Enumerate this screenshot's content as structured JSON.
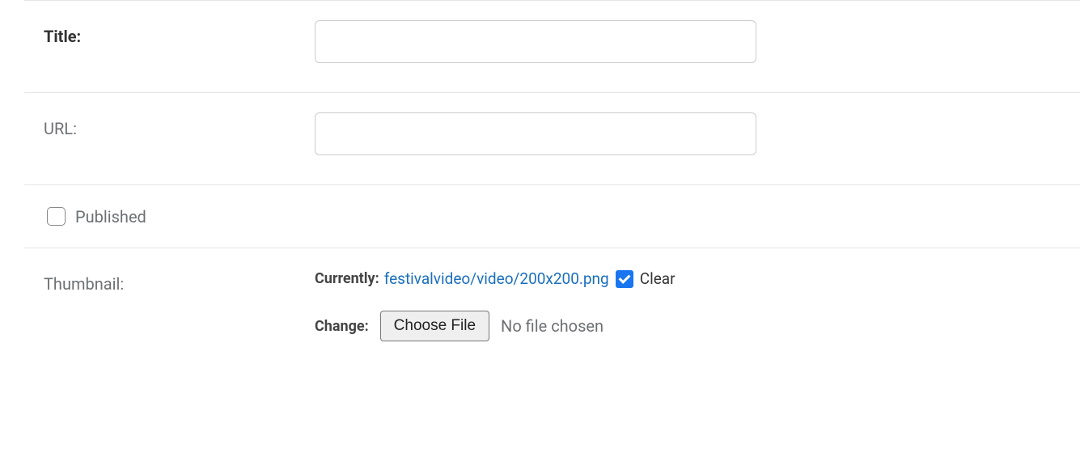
{
  "fields": {
    "title": {
      "label": "Title:",
      "value": "",
      "help": " "
    },
    "url": {
      "label": "URL:",
      "value": "",
      "help": " "
    },
    "published": {
      "label": "Published",
      "checked": false
    },
    "thumbnail": {
      "label": "Thumbnail:",
      "currently_label": "Currently:",
      "current_file": "festivalvideo/video/200x200.png",
      "clear_checked": true,
      "clear_label": "Clear",
      "change_label": "Change:",
      "choose_file_label": "Choose File",
      "no_file_text": "No file chosen"
    }
  }
}
